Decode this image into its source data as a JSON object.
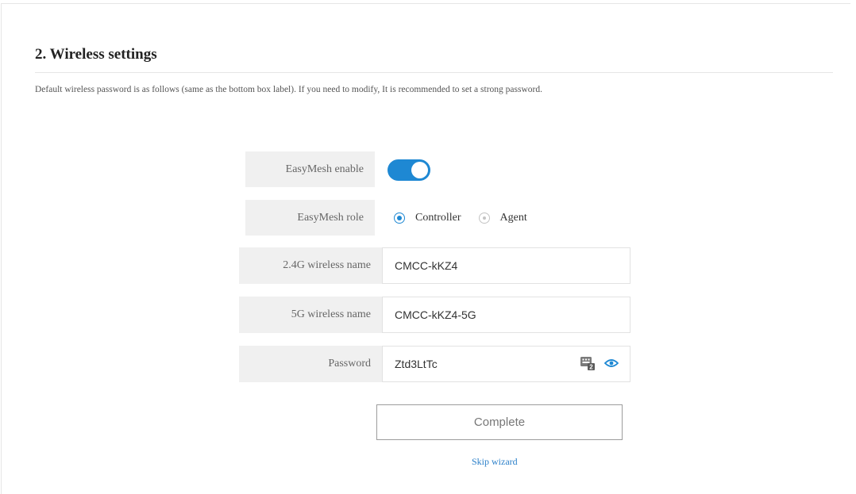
{
  "section": {
    "title": "2. Wireless settings",
    "description": "Default wireless password is as follows (same as the bottom box label). If you need to modify, It is recommended to set a strong password."
  },
  "easymesh_enable": {
    "label": "EasyMesh enable",
    "enabled": true
  },
  "easymesh_role": {
    "label": "EasyMesh role",
    "options": [
      "Controller",
      "Agent"
    ],
    "selected": "Controller"
  },
  "wireless_24g": {
    "label": "2.4G wireless name",
    "value": "CMCC-kKZ4"
  },
  "wireless_5g": {
    "label": "5G wireless name",
    "value": "CMCC-kKZ4-5G"
  },
  "password": {
    "label": "Password",
    "value": "Ztd3LtTc"
  },
  "actions": {
    "complete_label": "Complete",
    "skip_label": "Skip wizard"
  },
  "colors": {
    "accent": "#1e88d3",
    "link": "#2a7fc9",
    "label_bg": "#f0f0f0"
  },
  "icons": {
    "password_keyboard": "keyboard-icon",
    "password_visibility": "eye-icon"
  }
}
